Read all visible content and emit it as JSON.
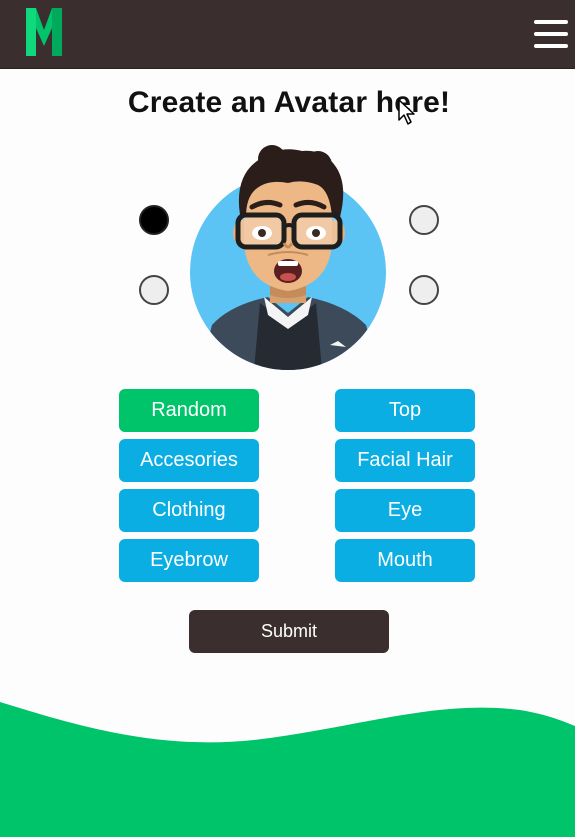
{
  "header": {
    "logo_letter": "M",
    "menu_icon": "hamburger-menu-icon"
  },
  "main": {
    "title": "Create an Avatar here!",
    "avatar_icon": "avatar-portrait-image",
    "radio_options": [
      {
        "position": "left-top",
        "selected": true
      },
      {
        "position": "left-bottom",
        "selected": false
      },
      {
        "position": "right-top",
        "selected": false
      },
      {
        "position": "right-bottom",
        "selected": false
      }
    ],
    "buttons": {
      "random": "Random",
      "top": "Top",
      "accesories": "Accesories",
      "facial_hair": "Facial Hair",
      "clothing": "Clothing",
      "eye": "Eye",
      "eyebrow": "Eyebrow",
      "mouth": "Mouth"
    },
    "submit_label": "Submit"
  },
  "colors": {
    "header_bg": "#3a2e2e",
    "brand_green": "#00c46a",
    "option_blue": "#0aaee3",
    "avatar_bg": "#5bc4f5"
  }
}
